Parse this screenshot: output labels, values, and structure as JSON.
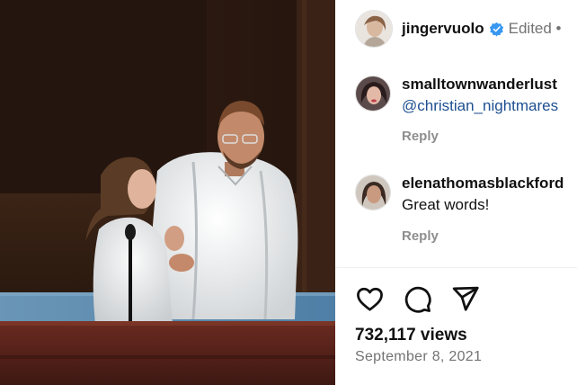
{
  "post": {
    "author": "jingervuolo",
    "edited_label": "Edited •",
    "avatar_icon": "profile-photo",
    "verified_icon": "verified-badge-icon",
    "verified_color": "#3897f0"
  },
  "comments": [
    {
      "username": "smalltownwanderlust",
      "text": "@christian_nightmares",
      "reply_label": "Reply"
    },
    {
      "username": "elenathomasblackford",
      "text": "Great words!",
      "reply_label": "Reply"
    }
  ],
  "actions": {
    "like_icon": "heart-icon",
    "comment_icon": "comment-icon",
    "share_icon": "send-icon"
  },
  "stats": {
    "views": "732,117 views",
    "date": "September 8, 2021"
  },
  "colors": {
    "mention": "#1d4f91",
    "muted": "#8e8e8e",
    "pool_water": "#5f8fb3",
    "curtain": "#3a2418"
  }
}
